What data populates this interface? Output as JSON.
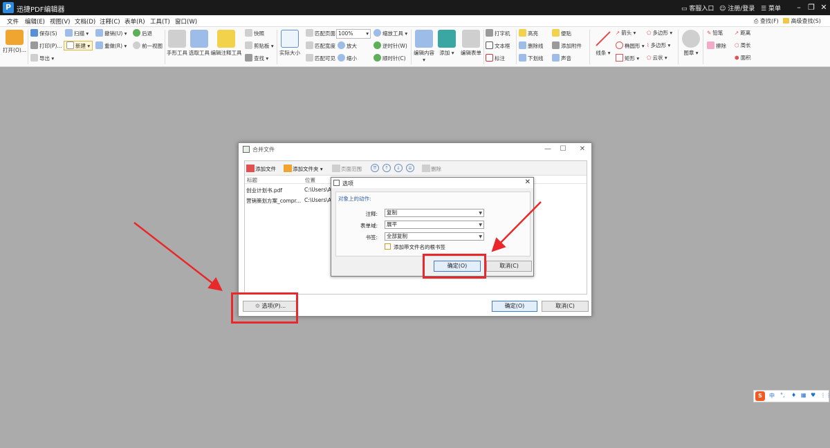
{
  "app": {
    "logo": "P",
    "title": "迅捷PDF编辑器"
  },
  "titlebar": {
    "service": "客服入口",
    "login": "注册/登录",
    "menu": "菜单"
  },
  "menubar": {
    "items": [
      "文件",
      "编辑(E)",
      "视图(V)",
      "文档(D)",
      "注释(C)",
      "表单(R)",
      "工具(T)",
      "窗口(W)"
    ],
    "find": "查找(F)",
    "advanced_find": "高级查找(S)"
  },
  "ribbon": {
    "open": "打开(O)...",
    "save": "保存(S)",
    "print": "打印(P)...",
    "export": "导出",
    "scan": "扫描",
    "new": "新建",
    "undo": "撤销(U)",
    "redo": "重做(R)",
    "back": "后退",
    "prev_view": "前一视图",
    "hand_tool": "手形工具",
    "select_tool": "选取工具",
    "edit_annot_tool": "编辑注释工具",
    "snapshot": "快照",
    "clipboard": "剪贴板",
    "find": "查找",
    "actual_size": "实际大小",
    "fit_page": "匹配页面",
    "fit_width": "匹配宽度",
    "fit_visible": "匹配可见",
    "zoom_value": "100%",
    "zoom_tool": "缩放工具",
    "zoom_in": "放大",
    "zoom_out": "缩小",
    "rotate_ccw": "逆时针(W)",
    "rotate_cw": "顺时针(C)",
    "edit_content": "编辑内容",
    "add": "添加",
    "edit_form": "编辑表单",
    "typewriter": "打字机",
    "textbox": "文本框",
    "callout": "标注",
    "highlight": "高亮",
    "strikeout": "删除线",
    "underline": "下划线",
    "note": "便贴",
    "attach": "添加附件",
    "sound": "声音",
    "line": "线条",
    "arrow": "箭头",
    "ellipse": "椭圆形",
    "rect": "矩形",
    "polygon": "多边形",
    "polyline": "多边形",
    "cloud": "云状",
    "stamp": "图章",
    "pencil": "铅笔",
    "eraser": "擦除",
    "distance": "距离",
    "perimeter": "周长",
    "area": "面积"
  },
  "merge_dialog": {
    "title": "合并文件",
    "toolbar": {
      "add_file": "添加文件",
      "add_folder": "添加文件夹",
      "page_range": "页面范围",
      "delete": "删除"
    },
    "columns": [
      "标题",
      "位置"
    ],
    "files": [
      {
        "name": "创业计划书.pdf",
        "path": "C:\\Users\\A"
      },
      {
        "name": "营销策划方案_compr...",
        "path": "C:\\Users\\A"
      }
    ],
    "options_button": "选项(P)...",
    "ok": "确定(O)",
    "cancel": "取消(C)"
  },
  "options_dialog": {
    "title": "选项",
    "group": "对象上的动作:",
    "annot_label": "注释:",
    "annot_value": "复制",
    "form_label": "表单域:",
    "form_value": "展平",
    "bookmark_label": "书签:",
    "bookmark_value": "全部复制",
    "checkbox_label": "添加带文件名的根书签",
    "checkbox_checked": false,
    "ok": "确定(O)",
    "cancel": "取消(C)"
  },
  "ime": {
    "logo": "S",
    "lang": "中"
  },
  "colors": {
    "highlight": "#e8282a",
    "titlebar": "#1a1a1a",
    "workspace": "#ababab"
  }
}
